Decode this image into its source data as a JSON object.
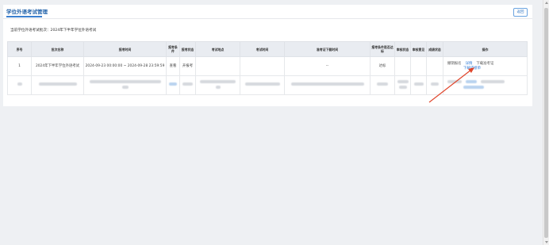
{
  "header": {
    "title": "学位外语考试管理",
    "back_label": "返回"
  },
  "batch": {
    "label": "当前学位外语考试批次：",
    "value": "2024年下半年学位外语考试"
  },
  "table": {
    "columns": [
      "序号",
      "批次名称",
      "报考时间",
      "报考条件",
      "报考状态",
      "考试地点",
      "考试时间",
      "准考证下载时间",
      "报考条件是否达标",
      "审核状态",
      "审核意见",
      "成绩状态",
      "操作"
    ],
    "row1": {
      "index": "1",
      "batch_name": "2024年下半年学位外语考试",
      "apply_time": "2024-09-23 00:00:00 ~ 2024-09-28 23:59:59",
      "condition": "查看",
      "status": "开报考",
      "exam_place": "",
      "exam_time": "",
      "ticket_time": "--",
      "qualified": "达标",
      "audit_status": "",
      "audit_opinion": "",
      "score_status": "",
      "ops": [
        "撤销报名",
        "详情",
        "下载准考证",
        "下载成绩单"
      ]
    }
  },
  "colors": {
    "accent": "#2e7bd6",
    "annotation_arrow": "#e0452b"
  }
}
